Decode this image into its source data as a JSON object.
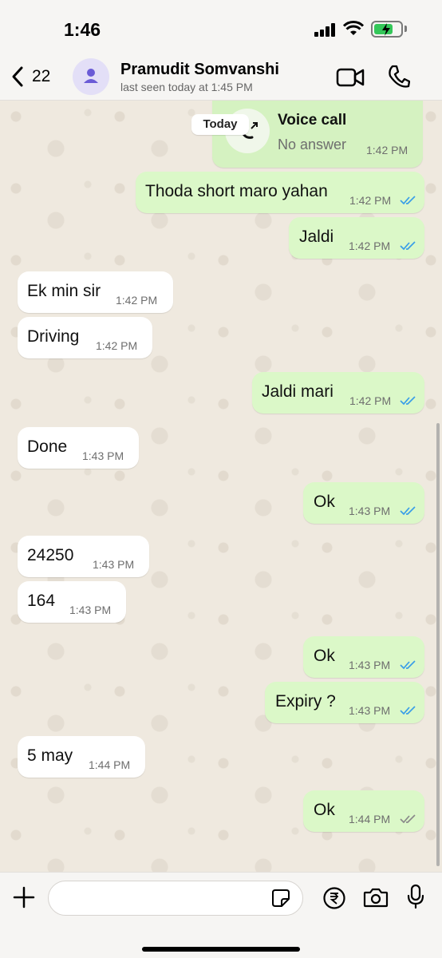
{
  "status_bar": {
    "time": "1:46"
  },
  "header": {
    "back_count": "22",
    "contact_name": "Pramudit Somvanshi",
    "last_seen": "last seen today at 1:45 PM"
  },
  "date_label": "Today",
  "call": {
    "title": "Voice call",
    "subtitle": "No answer",
    "time": "1:42 PM"
  },
  "messages": [
    {
      "dir": "out",
      "text": "Thoda short maro yahan",
      "time": "1:42 PM",
      "ticks": "read"
    },
    {
      "dir": "out",
      "text": "Jaldi",
      "time": "1:42 PM",
      "ticks": "read"
    },
    {
      "dir": "in",
      "text": "Ek min sir",
      "time": "1:42 PM"
    },
    {
      "dir": "in",
      "text": "Driving",
      "time": "1:42 PM"
    },
    {
      "dir": "out",
      "text": "Jaldi mari",
      "time": "1:42 PM",
      "ticks": "read"
    },
    {
      "dir": "in",
      "text": "Done",
      "time": "1:43 PM"
    },
    {
      "dir": "out",
      "text": "Ok",
      "time": "1:43 PM",
      "ticks": "read"
    },
    {
      "dir": "in",
      "text": "24250",
      "time": "1:43 PM"
    },
    {
      "dir": "in",
      "text": "164",
      "time": "1:43 PM"
    },
    {
      "dir": "out",
      "text": "Ok",
      "time": "1:43 PM",
      "ticks": "read"
    },
    {
      "dir": "out",
      "text": "Expiry ?",
      "time": "1:43 PM",
      "ticks": "read"
    },
    {
      "dir": "in",
      "text": "5 may",
      "time": "1:44 PM"
    },
    {
      "dir": "out",
      "text": "Ok",
      "time": "1:44 PM",
      "ticks": "delivered"
    }
  ],
  "composer": {
    "placeholder": ""
  },
  "colors": {
    "outgoing": "#dbf8c8",
    "incoming": "#ffffff",
    "read_tick": "#3a9ee8",
    "delivered_tick": "#8a8a8a"
  },
  "icons": [
    "back-chevron-icon",
    "person-icon",
    "video-call-icon",
    "phone-icon",
    "missed-call-icon",
    "plus-icon",
    "sticker-icon",
    "rupee-icon",
    "camera-icon",
    "mic-icon"
  ]
}
